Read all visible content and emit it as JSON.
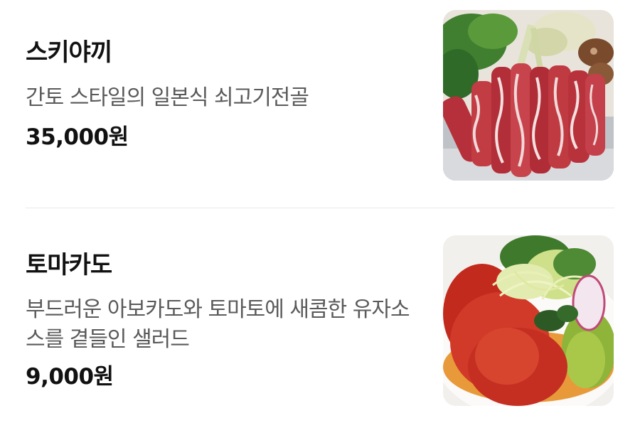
{
  "menu": {
    "items": [
      {
        "name": "스키야끼",
        "description": "간토 스타일의 일본식 쇠고기전골",
        "price": "35,000원",
        "photo_icon": "sukiyaki-photo"
      },
      {
        "name": "토마카도",
        "description": "부드러운 아보카도와 토마토에 새콤한 유자소스를 곁들인 샐러드",
        "price": "9,000원",
        "photo_icon": "tomacado-salad-photo"
      }
    ]
  },
  "colors": {
    "name_text": "#111111",
    "description_text": "#5a5a5a",
    "price_text": "#111111",
    "divider": "#e9e9e9",
    "background": "#ffffff"
  }
}
